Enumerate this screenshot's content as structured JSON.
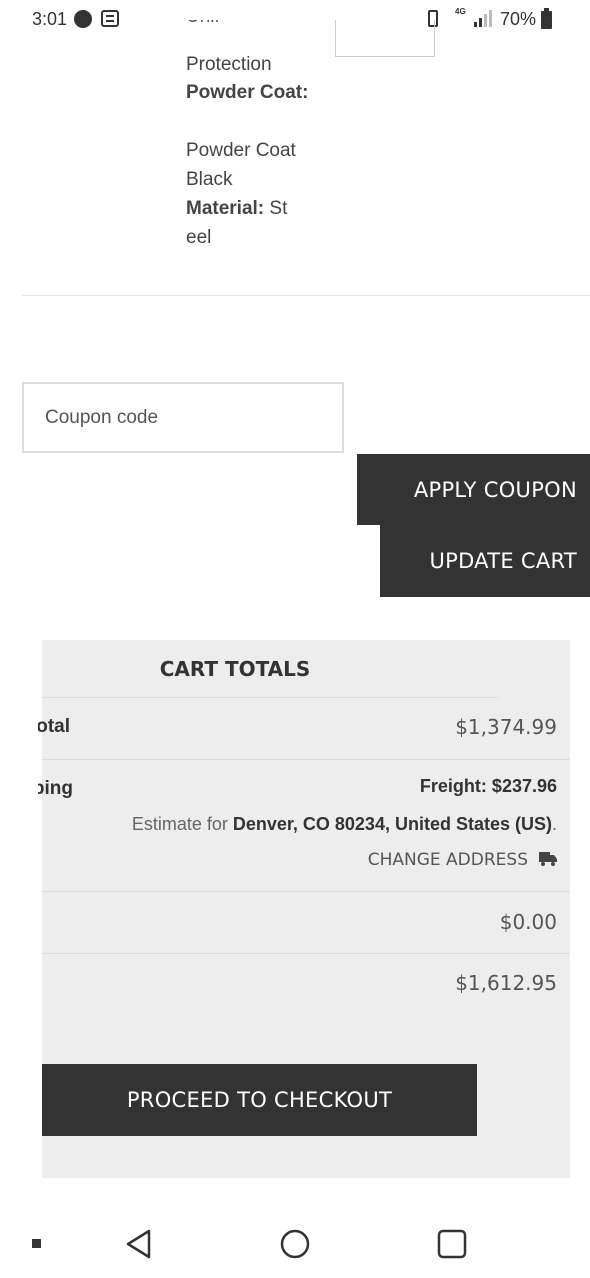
{
  "status_bar": {
    "time": "3:01",
    "network": "4G",
    "battery": "70%"
  },
  "product": {
    "cut_text": "Unif",
    "protection": "Protection",
    "powder_coat_label": "Powder Coat:",
    "powder_coat_value": "Powder Coat Black",
    "material_label": "Material:",
    "material_value": "Steel"
  },
  "coupon": {
    "placeholder": "Coupon code",
    "apply_label": "APPLY COUPON",
    "update_label": "UPDATE CART"
  },
  "cart_totals": {
    "title": "CART TOTALS",
    "subtotal_label": "Subtotal",
    "subtotal_value": "$1,374.99",
    "shipping_label": "Shipping",
    "freight_label": "Freight: $",
    "freight_value": "237.96",
    "estimate_prefix": "Estimate for ",
    "estimate_location": "Denver, CO 80234, United States (US)",
    "estimate_suffix": ".",
    "change_address": "CHANGE ADDRESS",
    "tax_value": "$0.00",
    "total_value": "$1,612.95",
    "checkout_label": "PROCEED TO CHECKOUT"
  },
  "colors": {
    "dark_button": "#333333",
    "panel_bg": "#ededed"
  },
  "icons": [
    "music-icon",
    "notes-icon",
    "vibrate-icon",
    "lte-icon",
    "signal-icon",
    "battery-icon",
    "truck-icon",
    "back-icon",
    "home-icon",
    "recents-icon",
    "menu-dot-icon"
  ]
}
